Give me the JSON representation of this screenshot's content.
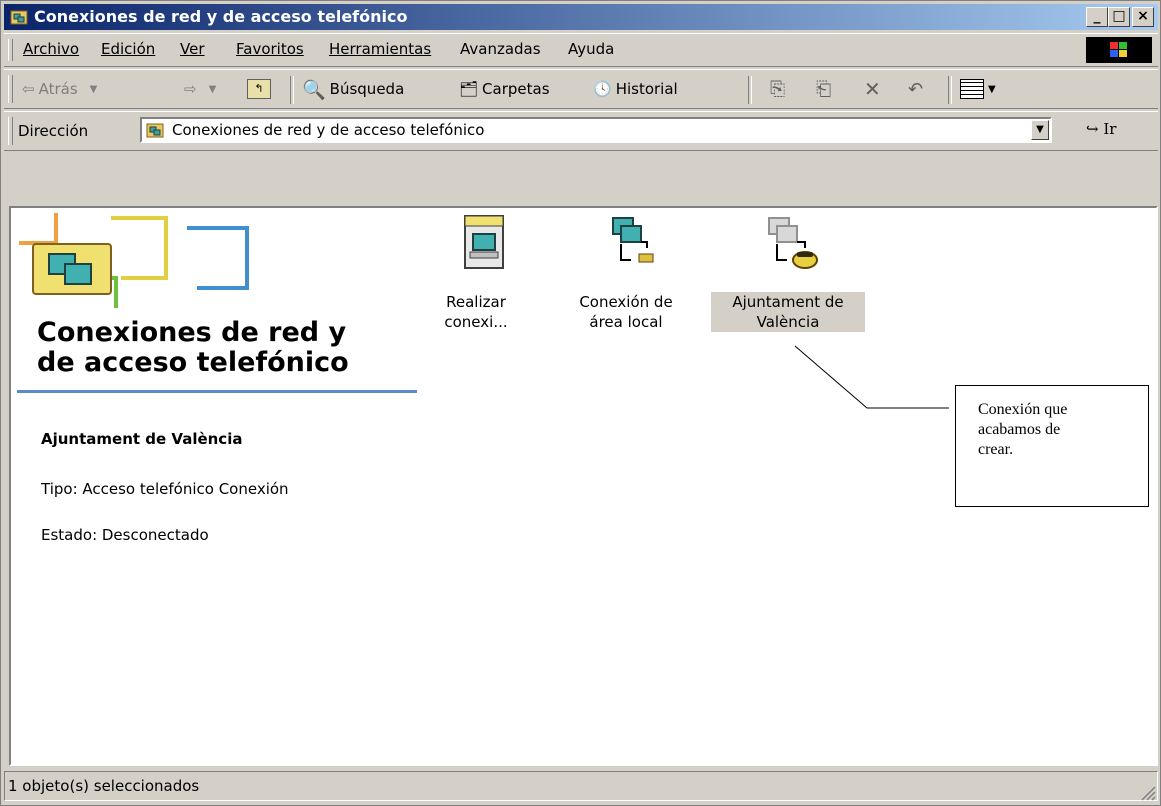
{
  "window": {
    "title": "Conexiones de red y de acceso telefónico",
    "controls": [
      "_",
      "□",
      "×"
    ]
  },
  "menu": {
    "items": [
      "Archivo",
      "Edición",
      "Ver",
      "Favoritos",
      "Herramientas",
      "Avanzadas",
      "Ayuda"
    ]
  },
  "toolbar": {
    "back": "Atrás",
    "search": "Búsqueda",
    "folders": "Carpetas",
    "history": "Historial"
  },
  "address": {
    "label": "Dirección",
    "value": "Conexiones de red y de acceso telefónico",
    "go": "Ir"
  },
  "sidebar": {
    "title_line1": "Conexiones de red y",
    "title_line2": "de acceso telefónico",
    "selected_name": "Ajuntament de València",
    "type": "Tipo: Acceso telefónico Conexión",
    "status": "Estado: Desconectado"
  },
  "icons": [
    {
      "line1": "Realizar",
      "line2": "conexi..."
    },
    {
      "line1": "Conexión de",
      "line2": "área local"
    },
    {
      "line1": "Ajuntament de",
      "line2": "València"
    }
  ],
  "callout": {
    "line1": "Conexión que",
    "line2": "acabamos de",
    "line3": "crear."
  },
  "statusbar": {
    "text": "1 objeto(s) seleccionados"
  }
}
